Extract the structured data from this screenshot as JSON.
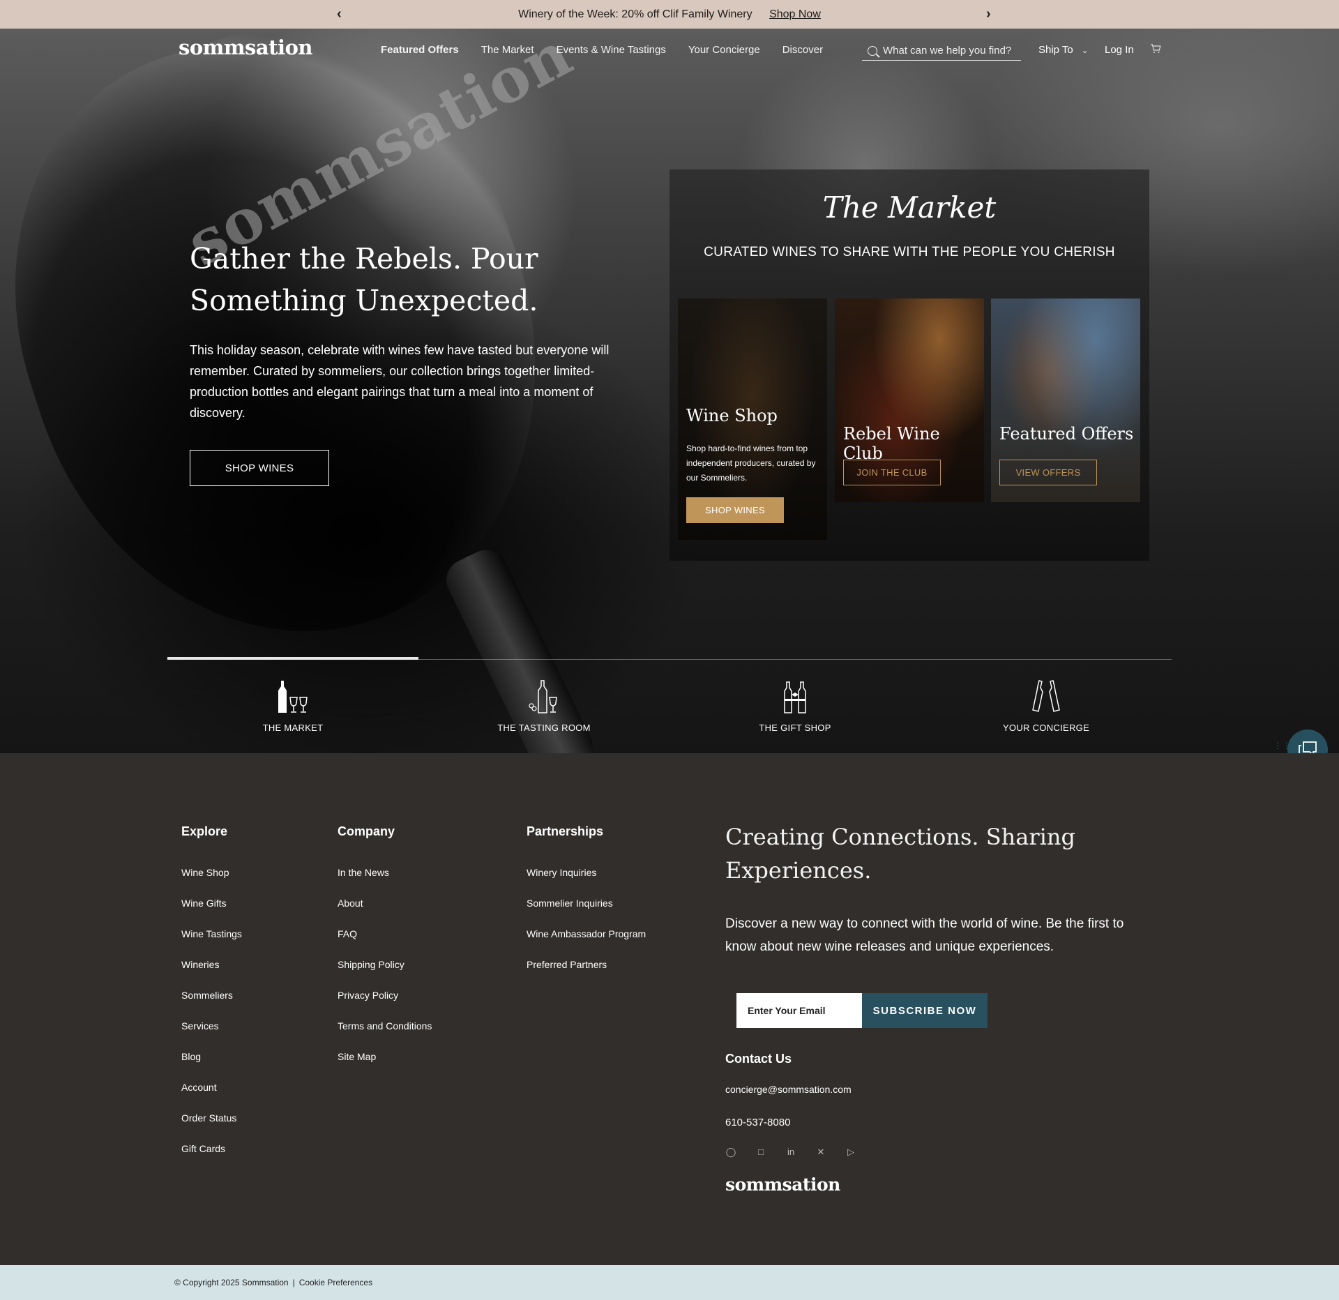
{
  "announcement": {
    "message": "Winery of the Week: 20% off Clif Family Winery",
    "link": "Shop Now"
  },
  "nav": {
    "logo": "sommsation",
    "links": [
      "Featured Offers",
      "The Market",
      "Events & Wine Tastings",
      "Your Concierge",
      "Discover"
    ],
    "search_placeholder": "What can we help you find?",
    "ship_to": "Ship To",
    "login": "Log In"
  },
  "hero": {
    "glass_etch": "sommsation",
    "title": "Gather the Rebels. Pour Something Unexpected.",
    "description": "This holiday season, celebrate with wines few have tasted but everyone will remember. Curated by sommeliers, our collection brings together limited-production bottles and elegant pairings that turn a meal into a moment of discovery.",
    "button": "SHOP WINES"
  },
  "market": {
    "title": "The Market",
    "subtitle": "CURATED WINES TO SHARE WITH THE PEOPLE YOU CHERISH",
    "cards": [
      {
        "title": "Wine Shop",
        "description": "Shop hard-to-find wines from top independent producers, curated by our Sommeliers.",
        "button": "SHOP WINES"
      },
      {
        "title": "Rebel Wine Club",
        "button": "JOIN THE CLUB"
      },
      {
        "title": "Featured Offers",
        "button": "VIEW OFFERS"
      }
    ]
  },
  "tabs": [
    "THE MARKET",
    "THE TASTING ROOM",
    "THE GIFT SHOP",
    "YOUR CONCIERGE"
  ],
  "footer": {
    "explore": {
      "heading": "Explore",
      "items": [
        "Wine Shop",
        "Wine Gifts",
        "Wine Tastings",
        "Wineries",
        "Sommeliers",
        "Services",
        "Blog",
        "Account",
        "Order Status",
        "Gift Cards"
      ]
    },
    "company": {
      "heading": "Company",
      "items": [
        "In the News",
        "About",
        "FAQ",
        "Shipping Policy",
        "Privacy Policy",
        "Terms and Conditions",
        "Site Map"
      ]
    },
    "partnerships": {
      "heading": "Partnerships",
      "items": [
        "Winery Inquiries",
        "Sommelier Inquiries",
        "Wine Ambassador Program",
        "Preferred Partners"
      ]
    },
    "headline": "Creating Connections. Sharing Experiences.",
    "description": "Discover a new way to connect with the world of wine. Be the first to know about new wine releases and unique experiences.",
    "email_placeholder": "Enter Your Email",
    "subscribe": "SUBSCRIBE NOW",
    "contact_heading": "Contact Us",
    "contact_email": "concierge@sommsation.com",
    "contact_phone": "610-537-8080",
    "logo": "sommsation"
  },
  "copyright": {
    "text": "© Copyright 2025 Sommsation",
    "cookie": "Cookie Preferences"
  },
  "colors": {
    "announce_bg": "#d9c8bd",
    "footer_bg": "#312e2b",
    "accent_gold": "#c0955a",
    "accent_teal": "#28505f",
    "copyright_bg": "#d4e4e6"
  }
}
